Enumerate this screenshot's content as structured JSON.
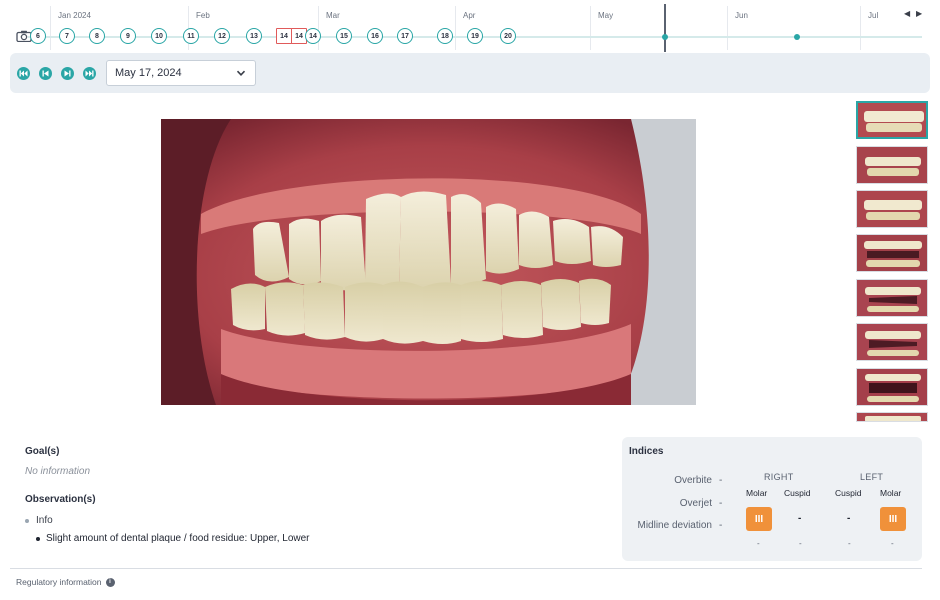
{
  "timeline": {
    "months": [
      "Jan 2024",
      "Feb",
      "Mar",
      "Apr",
      "May",
      "Jun",
      "Jul"
    ],
    "nodes": [
      "6",
      "7",
      "8",
      "9",
      "10",
      "11",
      "12",
      "13",
      "14",
      "14",
      "14",
      "15",
      "16",
      "17",
      "18",
      "19",
      "20"
    ],
    "nav_prev": "◀",
    "nav_next": "▶"
  },
  "toolbar": {
    "selected_date": "May 17, 2024"
  },
  "goals": {
    "title": "Goal(s)",
    "value": "No information"
  },
  "observations": {
    "title": "Observation(s)",
    "category": "Info",
    "items": [
      "Slight amount of dental plaque / food residue: Upper, Lower"
    ]
  },
  "indices": {
    "title": "Indices",
    "rows": [
      "Overbite",
      "Overjet",
      "Midline deviation"
    ],
    "row_dash": "-",
    "right_label": "RIGHT",
    "left_label": "LEFT",
    "col_molar": "Molar",
    "col_cuspid": "Cuspid",
    "right_molar": "III",
    "right_cuspid": "-",
    "left_cuspid": "-",
    "left_molar": "III",
    "sub_dash": "-"
  },
  "footer": {
    "regulatory": "Regulatory information",
    "info_glyph": "i"
  },
  "colors": {
    "accent": "#2aa6a6",
    "badge": "#f0913a",
    "flag": "#e05a5a"
  },
  "icons": {
    "camera": "camera-icon",
    "first": "skip-first-icon",
    "prev": "step-back-icon",
    "next": "step-forward-icon",
    "last": "skip-last-icon",
    "chevron": "chevron-down-icon",
    "info": "info-icon"
  }
}
